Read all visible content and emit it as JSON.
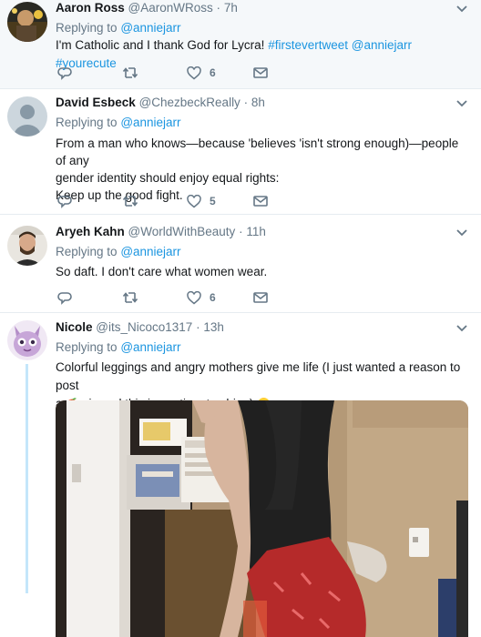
{
  "tweets": [
    {
      "name": "Aaron Ross",
      "handle": "@AaronWRoss",
      "dot": "·",
      "time": "7h",
      "reply_prefix": "Replying to",
      "reply_to": "@anniejarr",
      "text_parts": [
        "I'm Catholic and I thank God for Lycra! ",
        "#firstevertweet",
        " ",
        "@anniejarr",
        " ",
        "#yourecute"
      ],
      "likes": "6"
    },
    {
      "name": "David Esbeck",
      "handle": "@ChezbeckReally",
      "dot": "·",
      "time": "8h",
      "reply_prefix": "Replying to",
      "reply_to": "@anniejarr",
      "text_lines": [
        "From a man who knows—because 'believes 'isn't strong enough)—people of any",
        "gender identity should enjoy equal rights:",
        "Keep up the good fight."
      ],
      "likes": "5"
    },
    {
      "name": "Aryeh Kahn",
      "handle": "@WorldWithBeauty",
      "dot": "·",
      "time": "11h",
      "reply_prefix": "Replying to",
      "reply_to": "@anniejarr",
      "text": "So daft. I don't care what women wear.",
      "likes": "6"
    },
    {
      "name": "Nicole",
      "handle": "@its_Nicoco1317",
      "dot": "·",
      "time": "13h",
      "reply_prefix": "Replying to",
      "reply_to": "@anniejarr",
      "text_line1": "Colorful leggings and angry mothers give me life (I just wanted a reason to post",
      "text_line2_a": "a ",
      "text_line2_b": " pic and this is my time to shine) "
    }
  ],
  "icons": {
    "reply": "reply-icon",
    "retweet": "retweet-icon",
    "like": "heart-icon",
    "dm": "envelope-icon",
    "caret": "chevron-down-icon",
    "peach": "peach-emoji",
    "laugh": "tears-of-joy-emoji"
  },
  "colors": {
    "link": "#1b95e0",
    "muted": "#657786",
    "thread": "#c4e6fa"
  }
}
